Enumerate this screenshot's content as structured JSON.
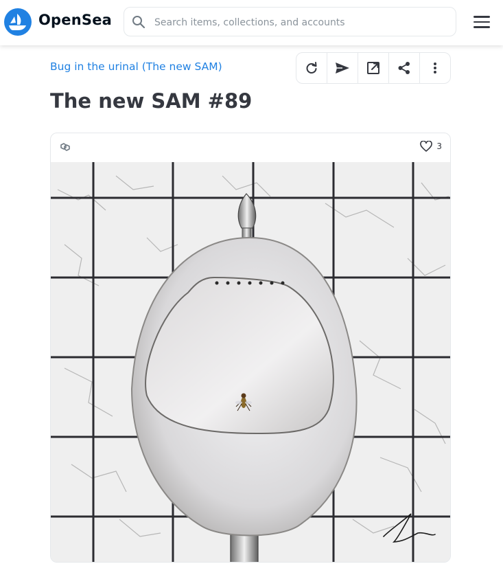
{
  "header": {
    "brand": "OpenSea",
    "search_placeholder": "Search items, collections, and accounts"
  },
  "collection": {
    "name": "Bug in the urinal (The new SAM)"
  },
  "item": {
    "title": "The new SAM #89",
    "favorites": "3"
  },
  "toolbar": {
    "buttons": [
      "refresh-icon",
      "transfer-icon",
      "external-link-icon",
      "share-icon",
      "more-icon"
    ]
  },
  "colors": {
    "accent": "#2081e2",
    "text": "#353840",
    "border": "#e5e8eb"
  }
}
